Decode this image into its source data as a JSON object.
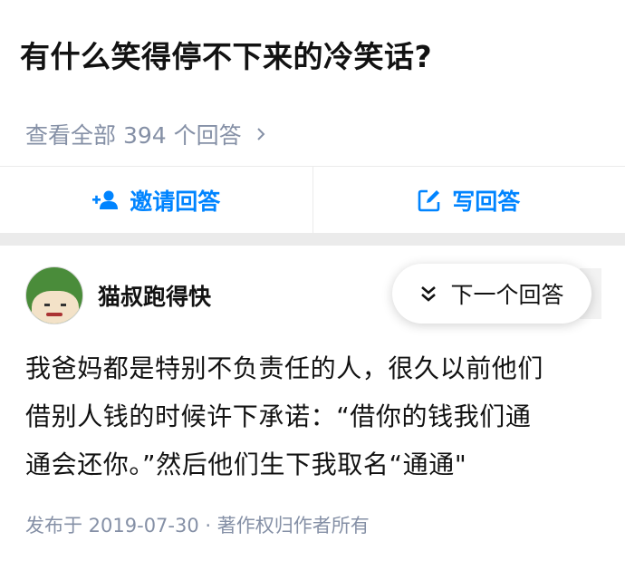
{
  "question": {
    "title": "有什么笑得停不下来的冷笑话?",
    "view_all": "查看全部 394 个回答"
  },
  "actions": {
    "invite_label": "邀请回答",
    "write_label": "写回答"
  },
  "answer": {
    "author_name": "猫叔跑得快",
    "next_label": "下一个回答",
    "body_lines": [
      "我爸妈都是特别不负责任的人，很久以前他们",
      "借别人钱的时候许下承诺：“借你的钱我们通",
      "通会还你。”然后他们生下我取名“通通\""
    ],
    "meta": "发布于 2019-07-30 · 著作权归作者所有"
  },
  "colors": {
    "accent": "#0084ff",
    "muted": "#8590a6",
    "divider": "#ebebeb"
  }
}
